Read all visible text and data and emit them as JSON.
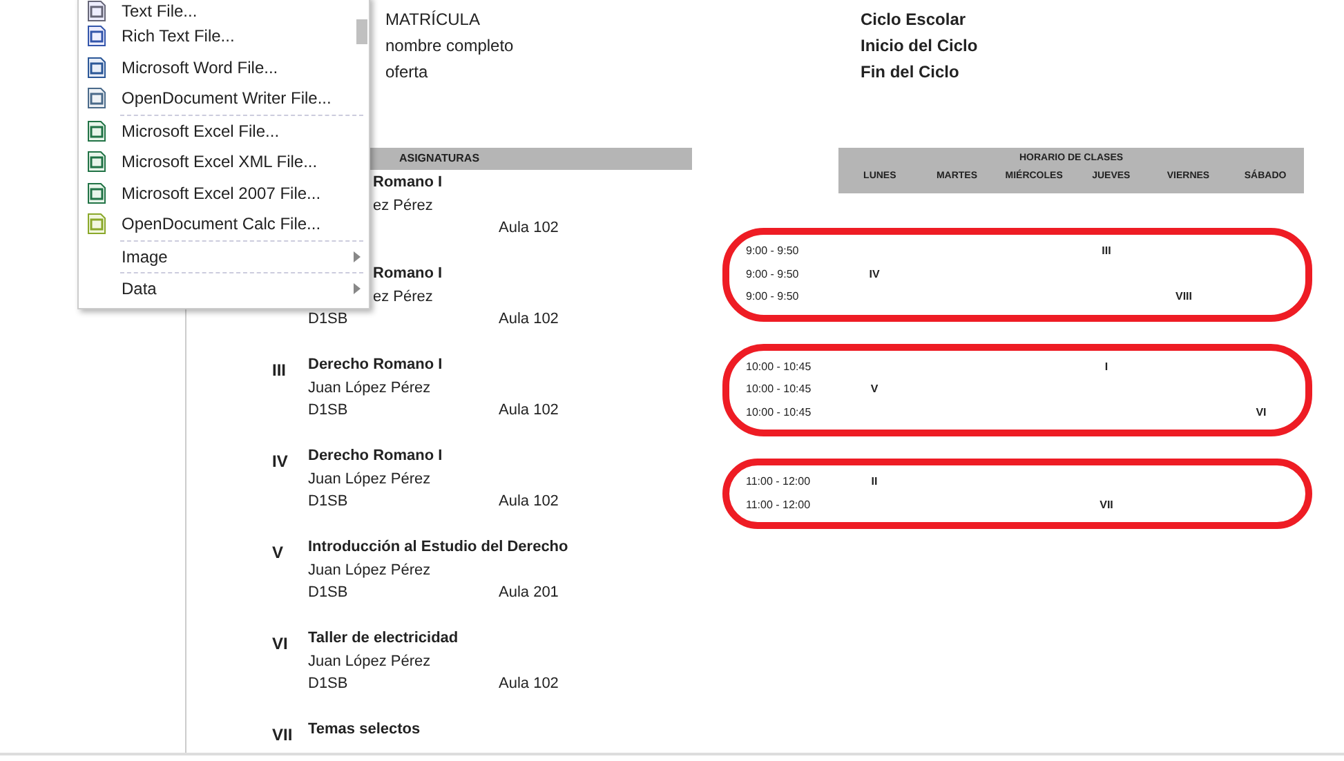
{
  "student": {
    "fields": [
      "MATRÍCULA",
      "nombre completo",
      "oferta"
    ],
    "cycle_fields": [
      "Ciclo Escolar",
      "Inicio del Ciclo",
      "Fin del Ciclo"
    ]
  },
  "subjects": {
    "header": "ASIGNATURAS",
    "items": [
      {
        "covered": true,
        "title": "Romano I",
        "teacher": "ez Pérez",
        "room": "Aula 102"
      },
      {
        "covered": true,
        "title": "Romano I",
        "teacher": "ez Pérez",
        "group": "D1SB",
        "room": "Aula 102"
      },
      {
        "covered": false,
        "numeral": "III",
        "title": "Derecho Romano I",
        "teacher": "Juan López Pérez",
        "group": "D1SB",
        "room": "Aula 102"
      },
      {
        "covered": false,
        "numeral": "IV",
        "title": "Derecho Romano I",
        "teacher": "Juan López Pérez",
        "group": "D1SB",
        "room": "Aula 102"
      },
      {
        "covered": false,
        "numeral": "V",
        "title": "Introducción al Estudio del Derecho",
        "teacher": "Juan López Pérez",
        "group": "D1SB",
        "room": "Aula 201"
      },
      {
        "covered": false,
        "numeral": "VI",
        "title": "Taller de electricidad",
        "teacher": "Juan López Pérez",
        "group": "D1SB",
        "room": "Aula 102"
      },
      {
        "covered": false,
        "numeral": "VII",
        "title": "Temas selectos"
      }
    ]
  },
  "schedule": {
    "header": "HORARIO DE CLASES",
    "days": [
      "LUNES",
      "MARTES",
      "MIÉRCOLES",
      "JUEVES",
      "VIERNES",
      "SÁBADO"
    ],
    "blocks": [
      {
        "rows": [
          {
            "time": "9:00 - 9:50",
            "kind": "thursday",
            "subject": "III"
          },
          {
            "time": "9:00 - 9:50",
            "kind": "monday",
            "subject": "IV"
          },
          {
            "time": "9:00 - 9:50",
            "kind": "friday",
            "subject": "VIII"
          }
        ]
      },
      {
        "rows": [
          {
            "time": "10:00 - 10:45",
            "kind": "thursday",
            "subject": "I"
          },
          {
            "time": "10:00 - 10:45",
            "kind": "monday",
            "subject": "V"
          },
          {
            "time": "10:00 - 10:45",
            "kind": "saturday",
            "subject": "VI"
          }
        ]
      },
      {
        "rows": [
          {
            "time": "11:00 - 12:00",
            "kind": "monday",
            "subject": "II"
          },
          {
            "time": "11:00 - 12:00",
            "kind": "thursday",
            "subject": "VII"
          }
        ]
      }
    ]
  },
  "export_menu": {
    "items": [
      {
        "kind": "text",
        "label": "Text File..."
      },
      {
        "kind": "rtf",
        "label": "Rich Text File..."
      },
      {
        "kind": "word",
        "label": "Microsoft Word File..."
      },
      {
        "kind": "odt",
        "label": "OpenDocument Writer File..."
      },
      {
        "kind": "separator"
      },
      {
        "kind": "excel",
        "label": "Microsoft Excel File..."
      },
      {
        "kind": "xml",
        "label": "Microsoft Excel XML File..."
      },
      {
        "kind": "excel",
        "label": "Microsoft Excel 2007 File..."
      },
      {
        "kind": "ods",
        "label": "OpenDocument Calc File..."
      },
      {
        "kind": "separator"
      },
      {
        "kind": "submenu",
        "label": "Image"
      },
      {
        "kind": "separator"
      },
      {
        "kind": "submenu",
        "label": "Data"
      }
    ]
  }
}
